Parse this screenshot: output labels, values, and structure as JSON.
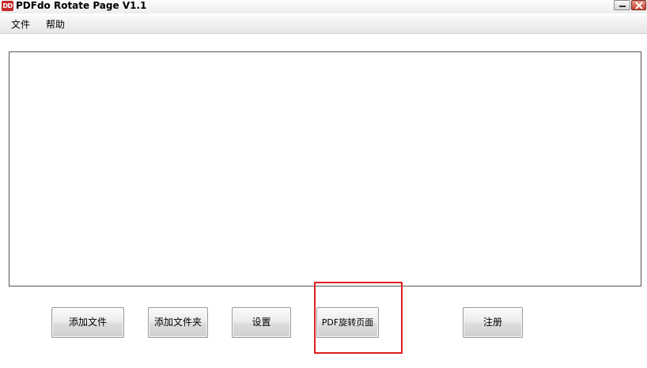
{
  "window": {
    "title": "PDFdo Rotate Page V1.1",
    "icon_text": "DD",
    "icon_name": "pdfdo-app-icon"
  },
  "menu": {
    "items": [
      "文件",
      "帮助"
    ]
  },
  "buttons": {
    "add_file": "添加文件",
    "add_folder": "添加文件夹",
    "settings": "设置",
    "rotate_pages": "PDF旋转页面",
    "register": "注册"
  },
  "colors": {
    "icon_red": "#c62828",
    "highlight_red": "#e02020",
    "close_red": "#c4432f"
  }
}
